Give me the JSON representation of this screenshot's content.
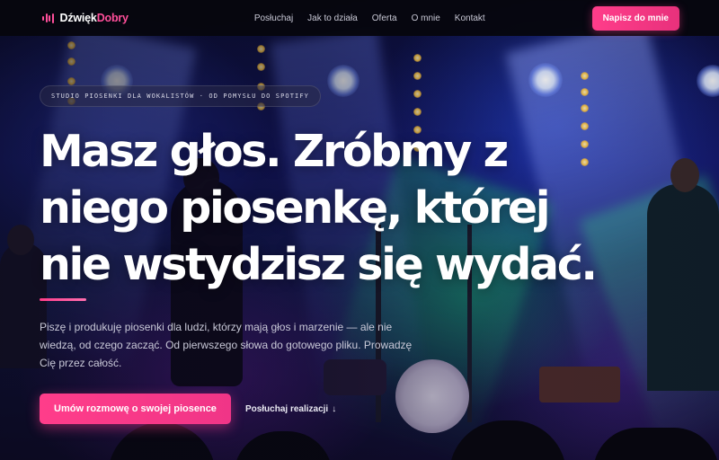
{
  "nav": {
    "brand_part1": "Dźwięk",
    "brand_part2": "Dobry",
    "links": [
      "Posłuchaj",
      "Jak to działa",
      "Oferta",
      "O mnie",
      "Kontakt"
    ],
    "cta": "Napisz do mnie"
  },
  "hero": {
    "eyebrow": "STUDIO PIOSENKI DLA WOKALISTÓW · OD POMYSŁU DO SPOTIFY",
    "headline_lines": [
      "Masz głos. Zróbmy z",
      "niego piosenkę, której",
      "nie wstydzisz się wydać."
    ],
    "lede": "Piszę i produkuję piosenki dla ludzi, którzy mają głos i marzenie — ale nie wiedzą, od czego zacząć. Od pierwszego słowa do gotowego pliku. Prowadzę Cię przez całość.",
    "primary_cta": "Umów rozmowę o swojej piosence",
    "secondary_cta": "Posłuchaj realizacji",
    "secondary_arrow": "↓"
  },
  "colors": {
    "accent": "#ff3d8a",
    "navbar_bg": "#06060e",
    "text_muted": "#c9c9d8"
  },
  "icons": {
    "brand": "sound-wave-icon",
    "secondary_cta": "arrow-down-icon"
  }
}
